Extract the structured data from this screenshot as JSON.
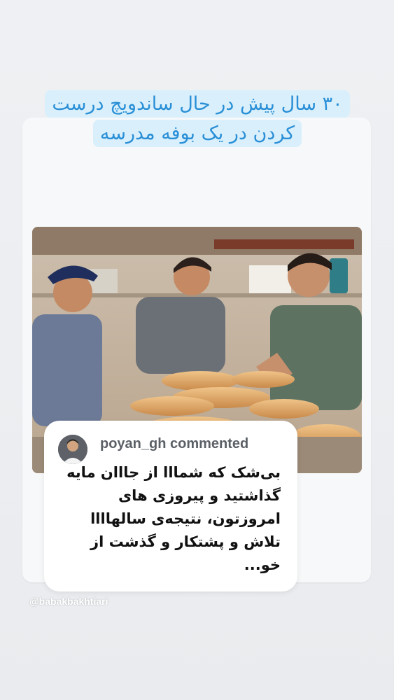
{
  "story": {
    "caption_lines": [
      "۳۰ سال پیش در حال ساندویچ درست",
      "کردن در یک بوفه مدرسه"
    ]
  },
  "comment": {
    "username": "poyan_gh commented",
    "text": "بی‌شک که شمااا از جااان مایه گذاشتید و پیروزی های امروزتون، نتیجه‌ی سالهاااا تلاش و پشتکار و گذشت از خو..."
  },
  "watermark": "@babakbakhtiari",
  "colors": {
    "caption_text": "#2a8fd6",
    "caption_bg": "#d9f0fc",
    "background": "#eceef1"
  }
}
